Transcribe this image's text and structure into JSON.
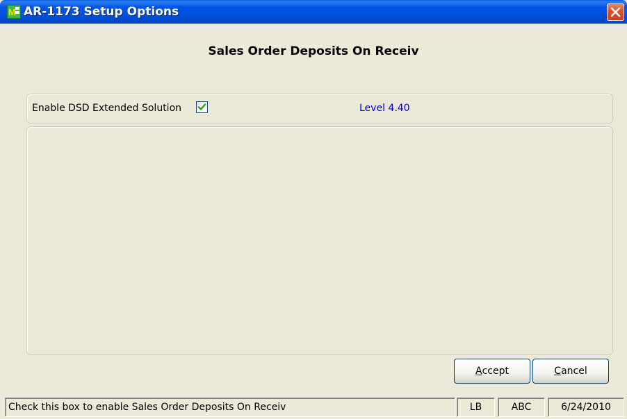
{
  "window": {
    "title": "AR-1173 Setup Options",
    "header_title": "Sales Order Deposits On Receiv"
  },
  "options": {
    "enable_label": "Enable DSD Extended Solution",
    "enable_checked": true,
    "level_text": "Level  4.40"
  },
  "buttons": {
    "accept_label": "Accept",
    "accept_mnemonic": "A",
    "accept_rest": "ccept",
    "cancel_label": "Cancel",
    "cancel_mnemonic": "C",
    "cancel_rest": "ancel"
  },
  "statusbar": {
    "message": "Check this box to enable Sales Order Deposits On Receiv",
    "user": "LB",
    "company": "ABC",
    "date": "6/24/2010"
  },
  "colors": {
    "titlebar": "#0055E5",
    "level_text": "#0000FF",
    "close_button": "#D9542B",
    "checkmark": "#21A121"
  },
  "icons": {
    "app": "mas90-app-icon",
    "close": "close-icon",
    "check": "checkmark-icon"
  }
}
